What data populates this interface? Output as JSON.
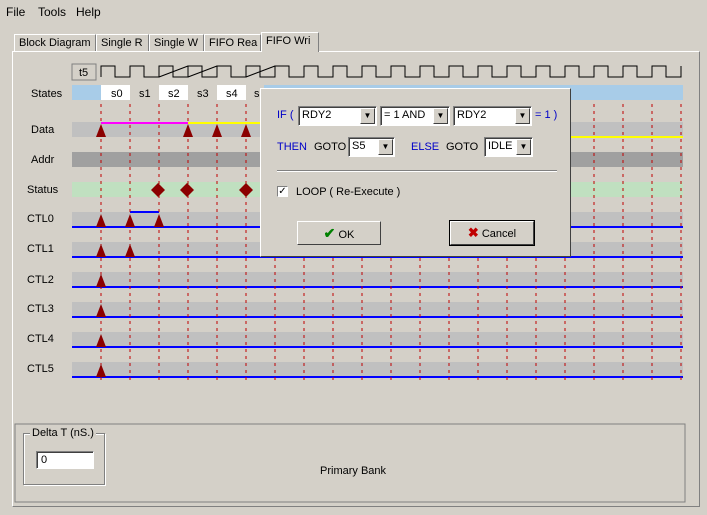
{
  "menu": {
    "file": "File",
    "tools": "Tools",
    "help": "Help"
  },
  "tabs": [
    "Block Diagram",
    "Single R",
    "Single W",
    "FIFO Rea",
    "FIFO Wri"
  ],
  "active_tab": "FIFO Wri",
  "timing": {
    "t_label": "t5",
    "rows": [
      "States",
      "Data",
      "Addr",
      "Status",
      "CTL0",
      "CTL1",
      "CTL2",
      "CTL3",
      "CTL4",
      "CTL5"
    ],
    "states": [
      "s0",
      "s1",
      "s2",
      "s3",
      "s4",
      "s"
    ]
  },
  "dialog": {
    "if_label": "IF (",
    "cond1": "RDY2",
    "op": "= 1  AND",
    "cond2": "RDY2",
    "eq_suffix": "= 1 )",
    "then_label": "THEN",
    "goto1": "GOTO",
    "then_target": "S5",
    "else_label": "ELSE",
    "goto2": "GOTO",
    "else_target": "IDLE",
    "loop_label": "LOOP  ( Re-Execute )",
    "loop_checked": true,
    "ok_label": "OK",
    "cancel_label": "Cancel"
  },
  "delta": {
    "legend": "Delta T (nS.)",
    "value": "0"
  },
  "bank_label": "Primary Bank",
  "colors": {
    "state_blue": "#a8cce8",
    "data_magenta": "#ff00ff",
    "data_yellow": "#ffff00",
    "status_green": "#c0e0c0",
    "wave_blue": "#0000ff",
    "marker_red": "#8b0000"
  }
}
